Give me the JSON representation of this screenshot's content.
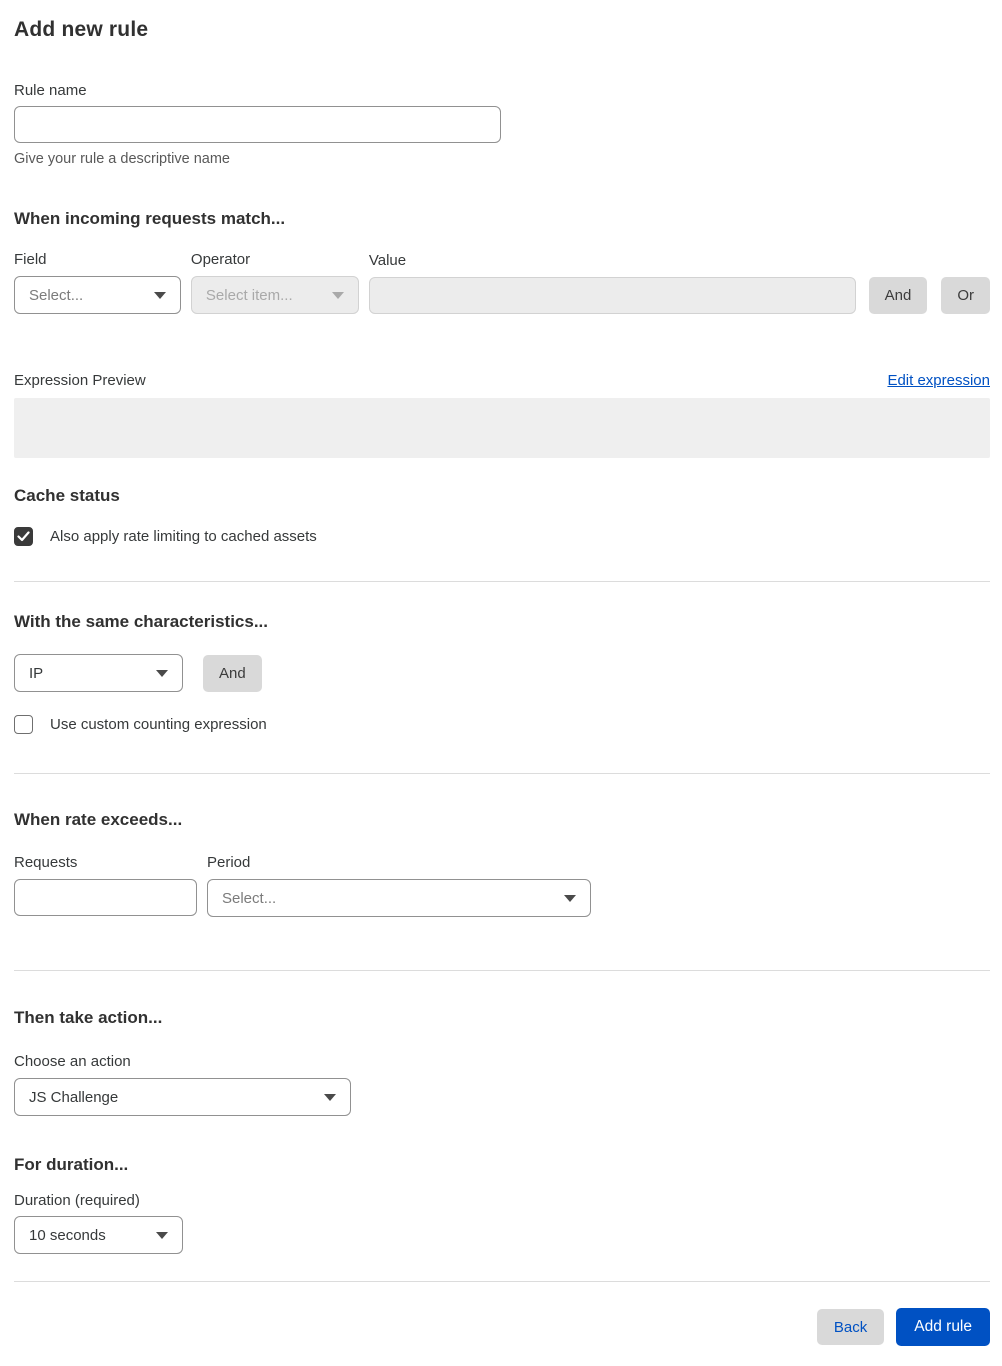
{
  "page": {
    "title": "Add new rule"
  },
  "rule_name": {
    "label": "Rule name",
    "value": "",
    "helper": "Give your rule a descriptive name"
  },
  "match": {
    "heading": "When incoming requests match...",
    "field": {
      "label": "Field",
      "selected": "Select..."
    },
    "operator": {
      "label": "Operator",
      "selected": "Select item..."
    },
    "value": {
      "label": "Value",
      "value": ""
    },
    "and_button": "And",
    "or_button": "Or"
  },
  "expression_preview": {
    "label": "Expression Preview",
    "edit_link": "Edit expression",
    "content": ""
  },
  "cache_status": {
    "heading": "Cache status",
    "checkbox_label": "Also apply rate limiting to cached assets",
    "checked": true
  },
  "characteristics": {
    "heading": "With the same characteristics...",
    "select_selected": "IP",
    "and_button": "And",
    "checkbox_label": "Use custom counting expression",
    "checked": false
  },
  "rate": {
    "heading": "When rate exceeds...",
    "requests": {
      "label": "Requests",
      "value": ""
    },
    "period": {
      "label": "Period",
      "selected": "Select..."
    }
  },
  "action": {
    "heading": "Then take action...",
    "label": "Choose an action",
    "selected": "JS Challenge"
  },
  "duration": {
    "heading": "For duration...",
    "label": "Duration (required)",
    "selected": "10 seconds"
  },
  "footer": {
    "back_button": "Back",
    "add_rule_button": "Add rule"
  },
  "colors": {
    "accent_blue": "#0051c3",
    "checkbox_checked": "#3a3a3a",
    "disabled_bg": "#ececec",
    "secondary_button_bg": "#d9d9d9"
  }
}
